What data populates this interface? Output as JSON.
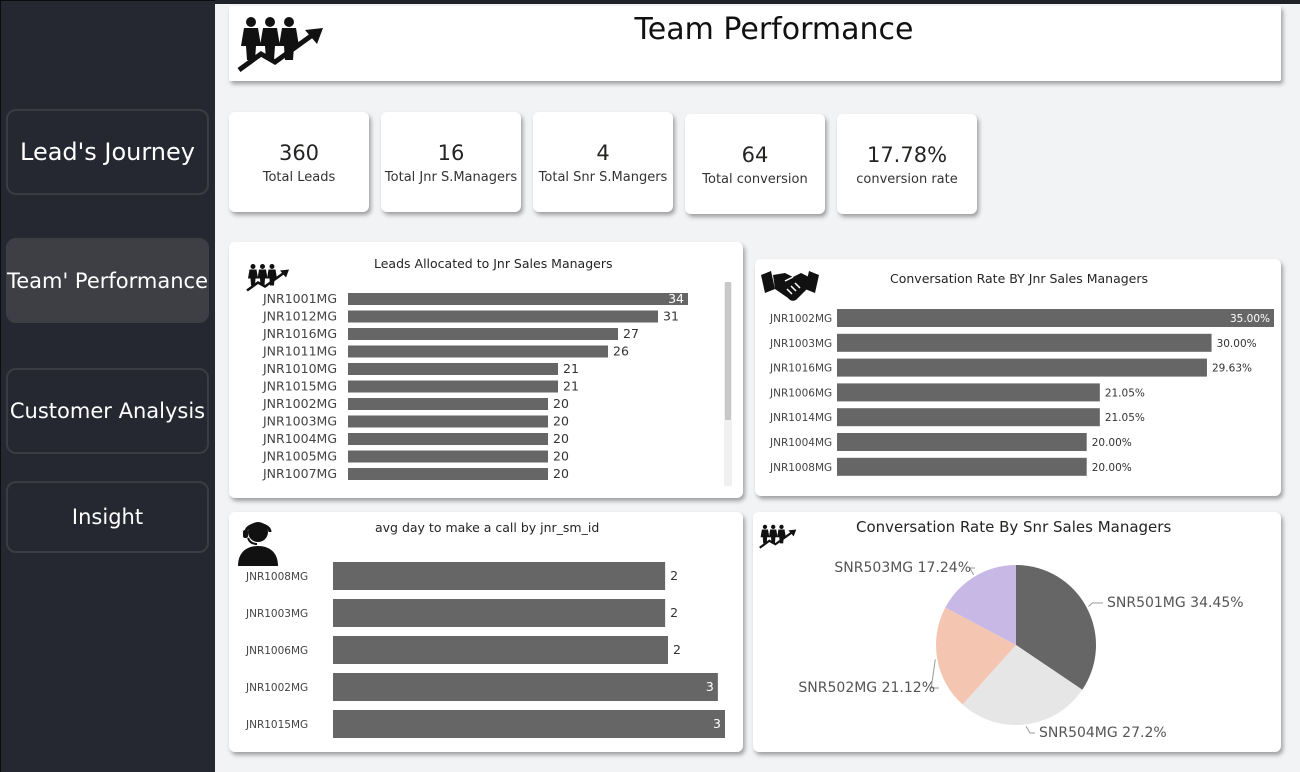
{
  "nav": {
    "leads_journey": "Lead's Journey",
    "team_performance": "Team' Performance",
    "customer_analysis": "Customer Analysis",
    "insight": "Insight"
  },
  "header": {
    "title": "Team Performance",
    "icon": "team-growth-icon"
  },
  "kpis": [
    {
      "value": "360",
      "label": "Total Leads"
    },
    {
      "value": "16",
      "label": "Total Jnr S.Managers"
    },
    {
      "value": "4",
      "label": "Total Snr S.Mangers"
    },
    {
      "value": "64",
      "label": "Total conversion"
    },
    {
      "value": "17.78%",
      "label": "conversion rate"
    }
  ],
  "colors": {
    "bar": "#666666",
    "sidebar": "#252830",
    "canvas": "#f2f3f5",
    "pie": [
      "#666666",
      "#e6e6e6",
      "#f4c6b2",
      "#c7b8e6"
    ]
  },
  "chart_data": [
    {
      "type": "bar",
      "orientation": "horizontal",
      "title": "Leads Allocated to Jnr Sales Managers",
      "icon": "team-growth-icon",
      "categories": [
        "JNR1001MG",
        "JNR1012MG",
        "JNR1016MG",
        "JNR1011MG",
        "JNR1010MG",
        "JNR1015MG",
        "JNR1002MG",
        "JNR1003MG",
        "JNR1004MG",
        "JNR1005MG",
        "JNR1007MG"
      ],
      "values": [
        34,
        31,
        27,
        26,
        21,
        21,
        20,
        20,
        20,
        20,
        20
      ],
      "labels": [
        "34",
        "31",
        "27",
        "26",
        "21",
        "21",
        "20",
        "20",
        "20",
        "20",
        "20"
      ],
      "xlim": [
        0,
        35
      ]
    },
    {
      "type": "bar",
      "orientation": "horizontal",
      "title": "Conversation Rate BY Jnr Sales Managers",
      "icon": "handshake-icon",
      "categories": [
        "JNR1002MG",
        "JNR1003MG",
        "JNR1016MG",
        "JNR1006MG",
        "JNR1014MG",
        "JNR1004MG",
        "JNR1008MG"
      ],
      "values": [
        35.0,
        30.0,
        29.63,
        21.05,
        21.05,
        20.0,
        20.0
      ],
      "labels": [
        "35.00%",
        "30.00%",
        "29.63%",
        "21.05%",
        "21.05%",
        "20.00%",
        "20.00%"
      ],
      "xlim": [
        0,
        35
      ]
    },
    {
      "type": "bar",
      "orientation": "horizontal",
      "title": "avg day to make a call by jnr_sm_id",
      "icon": "call-center-agent-icon",
      "categories": [
        "JNR1008MG",
        "JNR1003MG",
        "JNR1006MG",
        "JNR1002MG",
        "JNR1015MG"
      ],
      "values": [
        2.33,
        2.33,
        2.35,
        2.7,
        2.75
      ],
      "labels": [
        "2",
        "2",
        "2",
        "3",
        "3"
      ],
      "xlim": [
        0,
        2.75
      ]
    },
    {
      "type": "pie",
      "title": "Conversation Rate By Snr Sales Managers",
      "icon": "team-growth-icon",
      "categories": [
        "SNR501MG",
        "SNR504MG",
        "SNR502MG",
        "SNR503MG"
      ],
      "values": [
        34.45,
        27.2,
        21.12,
        17.24
      ],
      "labels": [
        "SNR501MG 34.45%",
        "SNR504MG 27.2%",
        "SNR502MG 21.12%",
        "SNR503MG 17.24%"
      ]
    }
  ]
}
